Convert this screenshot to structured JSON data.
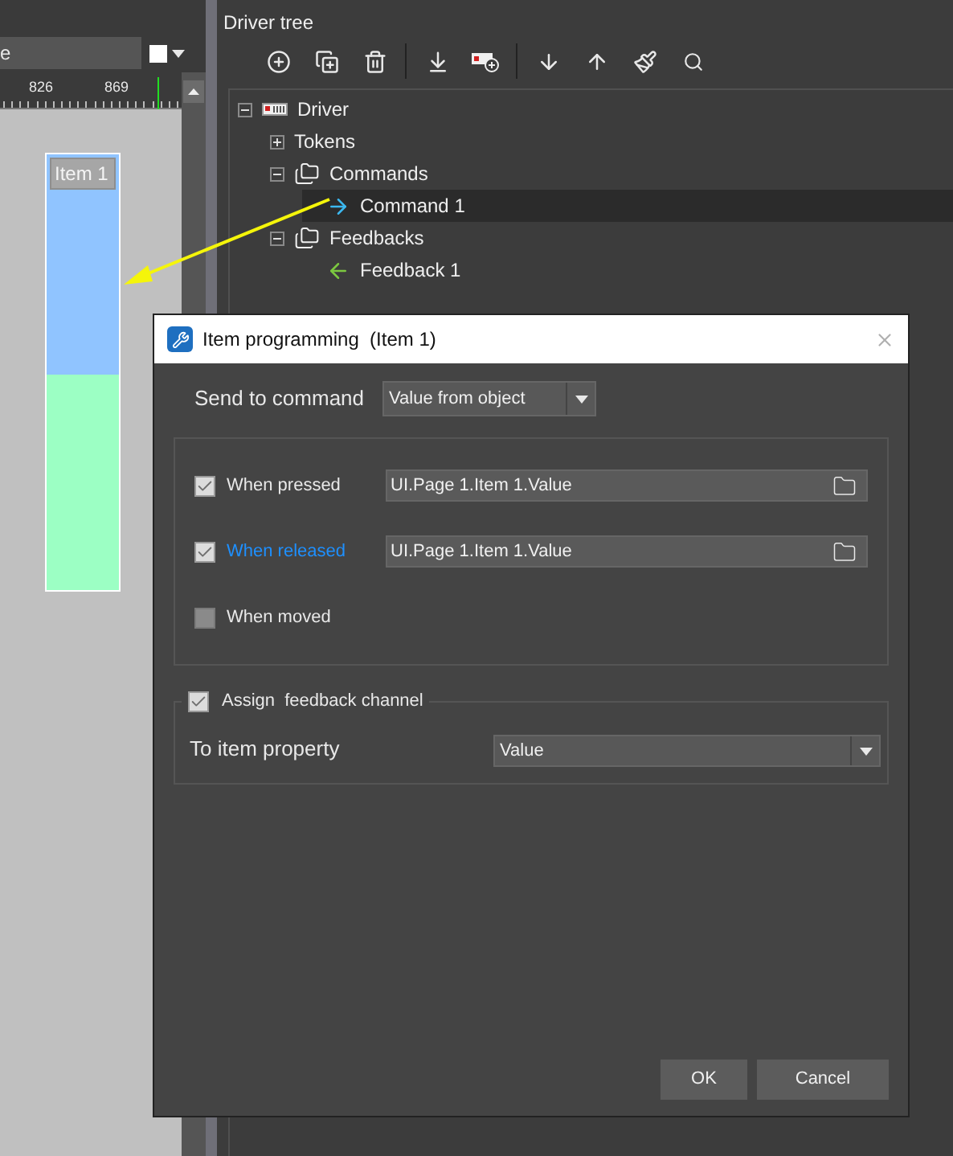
{
  "left_toolbar": {
    "dropdown_value": "e"
  },
  "ruler": {
    "labels": [
      "826",
      "869"
    ]
  },
  "canvas": {
    "item": {
      "label": "Item 1"
    }
  },
  "driver_tree": {
    "title": "Driver tree",
    "nodes": [
      {
        "label": "Driver",
        "kind": "driver",
        "expanded": true,
        "selected": false,
        "children": [
          {
            "label": "Tokens",
            "kind": "plain",
            "expanded": false,
            "selected": false
          },
          {
            "label": "Commands",
            "kind": "folder",
            "expanded": true,
            "selected": false,
            "children": [
              {
                "label": "Command 1",
                "kind": "command",
                "selected": true
              }
            ]
          },
          {
            "label": "Feedbacks",
            "kind": "folder",
            "expanded": true,
            "selected": false,
            "children": [
              {
                "label": "Feedback 1",
                "kind": "feedback",
                "selected": false
              }
            ]
          }
        ]
      }
    ]
  },
  "dialog": {
    "title": "Item programming  (Item 1)",
    "send_to_command": {
      "label": "Send to command",
      "value": "Value from object"
    },
    "triggers": [
      {
        "label": "When pressed",
        "checked": true,
        "highlighted": false,
        "path": "UI.Page 1.Item 1.Value"
      },
      {
        "label": "When released",
        "checked": true,
        "highlighted": true,
        "path": "UI.Page 1.Item 1.Value"
      },
      {
        "label": "When moved",
        "checked": false,
        "highlighted": false
      }
    ],
    "feedback": {
      "label": "Assign  feedback channel",
      "checked": true,
      "property_label": "To item property",
      "property_value": "Value"
    },
    "buttons": [
      "OK",
      "Cancel"
    ]
  }
}
